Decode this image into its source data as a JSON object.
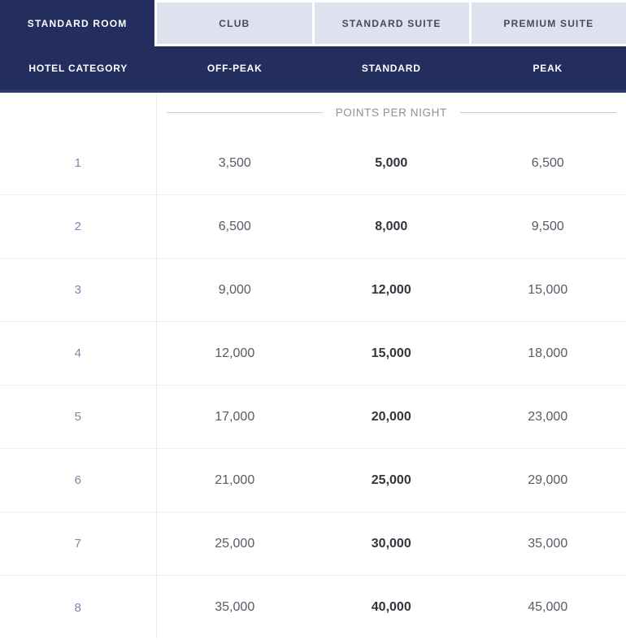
{
  "colors": {
    "navy": "#232e5f",
    "header_bottom_border": "#2d3a6d",
    "tab_inactive_bg": "#dde2ee",
    "tab_inactive_text": "#434c5c",
    "tab_active_text": "#ffffff",
    "section_label_text": "#8b909b",
    "section_line": "#c9cdd4",
    "category_text": "#7589b5",
    "value_text": "#565b66",
    "value_bold_text": "#32353d",
    "divider": "#ececec"
  },
  "tabs": [
    {
      "label": "STANDARD ROOM",
      "active": true
    },
    {
      "label": "CLUB",
      "active": false
    },
    {
      "label": "STANDARD SUITE",
      "active": false
    },
    {
      "label": "PREMIUM SUITE",
      "active": false
    }
  ],
  "header": {
    "columns": [
      "HOTEL CATEGORY",
      "OFF-PEAK",
      "STANDARD",
      "PEAK"
    ]
  },
  "body": {
    "section_label": "POINTS PER NIGHT",
    "rows": [
      {
        "category": "1",
        "off_peak": "3,500",
        "standard": "5,000",
        "peak": "6,500"
      },
      {
        "category": "2",
        "off_peak": "6,500",
        "standard": "8,000",
        "peak": "9,500"
      },
      {
        "category": "3",
        "off_peak": "9,000",
        "standard": "12,000",
        "peak": "15,000"
      },
      {
        "category": "4",
        "off_peak": "12,000",
        "standard": "15,000",
        "peak": "18,000"
      },
      {
        "category": "5",
        "off_peak": "17,000",
        "standard": "20,000",
        "peak": "23,000"
      },
      {
        "category": "6",
        "off_peak": "21,000",
        "standard": "25,000",
        "peak": "29,000"
      },
      {
        "category": "7",
        "off_peak": "25,000",
        "standard": "30,000",
        "peak": "35,000"
      },
      {
        "category": "8",
        "off_peak": "35,000",
        "standard": "40,000",
        "peak": "45,000"
      }
    ]
  }
}
